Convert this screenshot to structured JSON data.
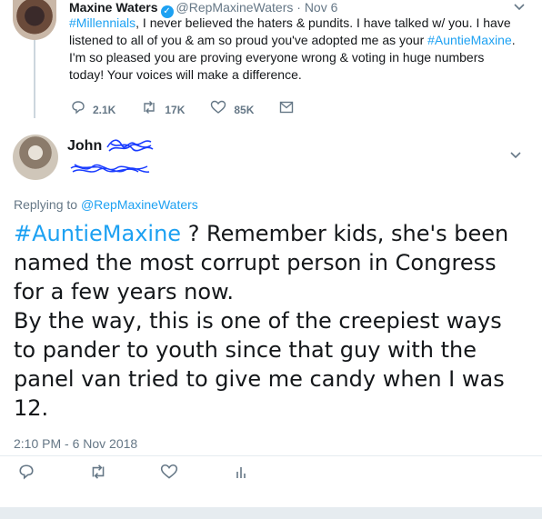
{
  "parent_tweet": {
    "name": "Maxine Waters",
    "handle": "@RepMaxineWaters",
    "separator": "·",
    "date": "Nov 6",
    "text_lines": [
      {
        "parts": [
          {
            "text": "#Millennials",
            "link": true
          },
          {
            "text": ", I never believed the haters & pundits. I have talked w/ you. I have",
            "link": false
          }
        ]
      },
      {
        "parts": [
          {
            "text": "listened to all of you & am so proud you've adopted me as your ",
            "link": false
          },
          {
            "text": "#AuntieMaxine",
            "link": true
          },
          {
            "text": ".",
            "link": false
          }
        ]
      },
      {
        "parts": [
          {
            "text": "I'm so pleased you are proving everyone wrong & voting in huge numbers",
            "link": false
          }
        ]
      },
      {
        "parts": [
          {
            "text": "today! Your voices will make a difference.",
            "link": false
          }
        ]
      }
    ],
    "reply_count": "2.1K",
    "retweet_count": "17K",
    "like_count": "85K"
  },
  "reply_tweet": {
    "name": "John",
    "replying_prefix": "Replying to",
    "replying_to": "@RepMaxineWaters",
    "hashtag": "#AuntieMaxine",
    "lines": [
      " ? Remember kids, she's been",
      "named the most corrupt  person in Congress",
      "for a few years now.",
      "By the way, this is one of the creepiest ways",
      "to pander to youth since that guy with the",
      "panel van tried to give me candy when I was",
      "12."
    ],
    "timestamp": "2:10 PM - 6 Nov 2018"
  },
  "icons": {
    "reply": "reply-icon",
    "retweet": "retweet-icon",
    "like": "heart-icon",
    "dm": "envelope-icon",
    "analytics": "analytics-icon",
    "chevron": "chevron-down-icon",
    "verified": "verified-badge-icon"
  },
  "colors": {
    "link": "#1da1f2",
    "muted": "#657786",
    "text": "#14171a",
    "scribble": "#1a3cff"
  }
}
